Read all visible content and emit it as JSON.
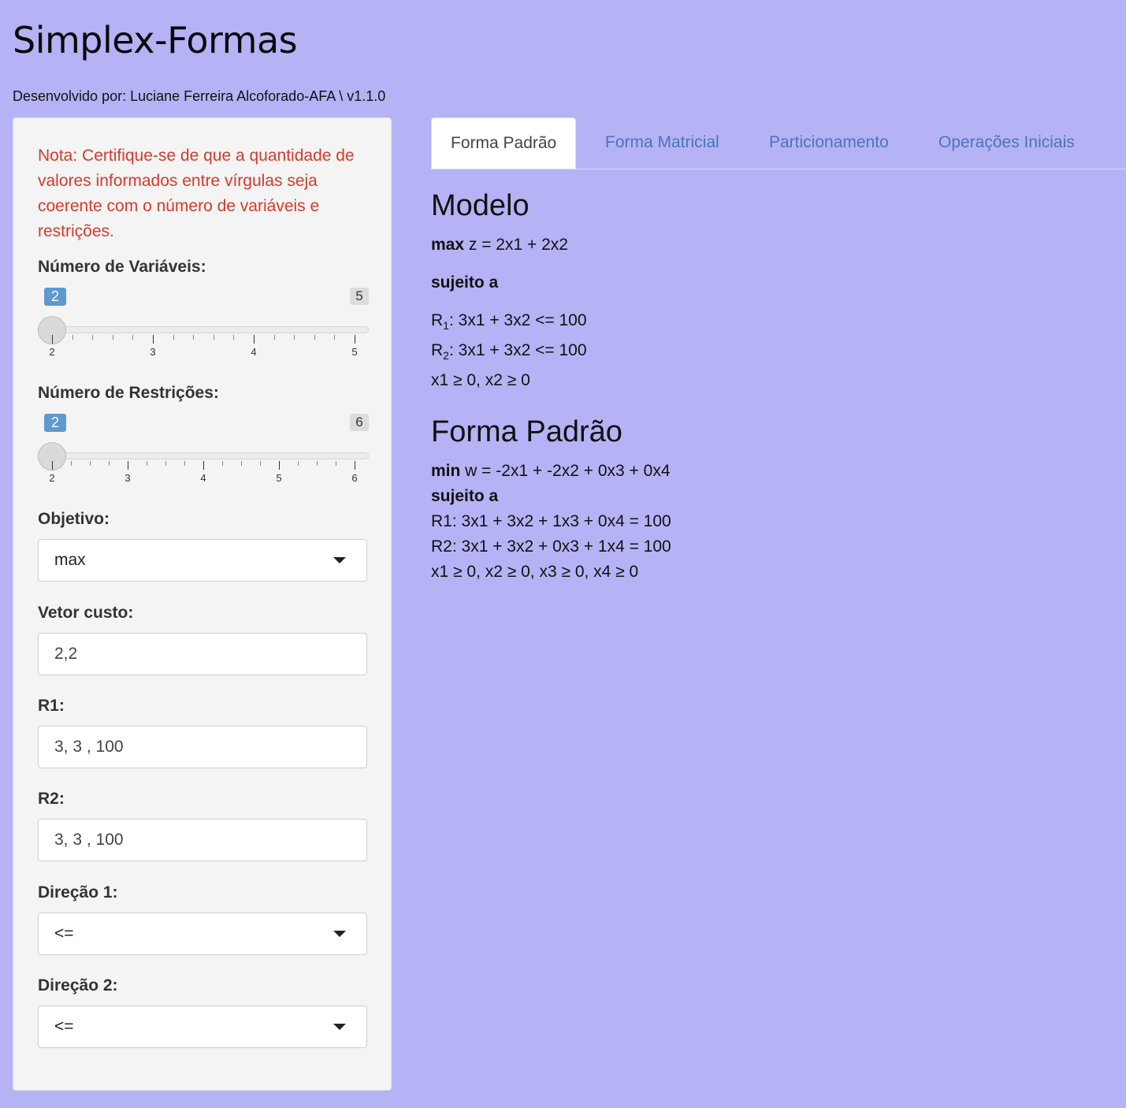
{
  "app": {
    "title": "Simplex-Formas",
    "subtitle": "Desenvolvido por: Luciane Ferreira Alcoforado-AFA \\ v1.1.0"
  },
  "sidebar": {
    "note": "Nota: Certifique-se de que a quantidade de valores informados entre vírgulas seja coerente com o número de variáveis e restrições.",
    "num_vars": {
      "label": "Número de Variáveis:",
      "value": "2",
      "max": "5",
      "ticks": [
        "2",
        "3",
        "4",
        "5"
      ]
    },
    "num_restr": {
      "label": "Número de Restrições:",
      "value": "2",
      "max": "6",
      "ticks": [
        "2",
        "3",
        "4",
        "5",
        "6"
      ]
    },
    "objetivo": {
      "label": "Objetivo:",
      "value": "max"
    },
    "vetor_custo": {
      "label": "Vetor custo:",
      "value": "2,2"
    },
    "r1": {
      "label": "R1:",
      "value": "3, 3 , 100"
    },
    "r2": {
      "label": "R2:",
      "value": "3, 3 , 100"
    },
    "direcao1": {
      "label": "Direção 1:",
      "value": "<="
    },
    "direcao2": {
      "label": "Direção 2:",
      "value": "<="
    }
  },
  "tabs": [
    {
      "label": "Forma Padrão",
      "active": true
    },
    {
      "label": "Forma Matricial"
    },
    {
      "label": "Particionamento"
    },
    {
      "label": "Operações Iniciais"
    }
  ],
  "main": {
    "modelo": {
      "heading": "Modelo",
      "obj_keyword": "max",
      "obj_expr": " z = 2x1 + 2x2",
      "subject": "sujeito a",
      "r1_name": "R",
      "r1_sub": "1",
      "r1_expr": ": 3x1 + 3x2 <= 100",
      "r2_name": "R",
      "r2_sub": "2",
      "r2_expr": ": 3x1 + 3x2 <= 100",
      "nonneg": "x1 ≥ 0, x2 ≥ 0"
    },
    "forma_padrao": {
      "heading": "Forma Padrão",
      "obj_keyword": "min",
      "obj_expr": " w = -2x1 + -2x2 + 0x3 + 0x4",
      "subject": "sujeito a",
      "r1": "R1: 3x1 + 3x2 + 1x3 + 0x4 = 100",
      "r2": "R2: 3x1 + 3x2 + 0x3 + 1x4 = 100",
      "nonneg": "x1 ≥ 0, x2 ≥ 0, x3 ≥ 0, x4 ≥ 0"
    }
  }
}
